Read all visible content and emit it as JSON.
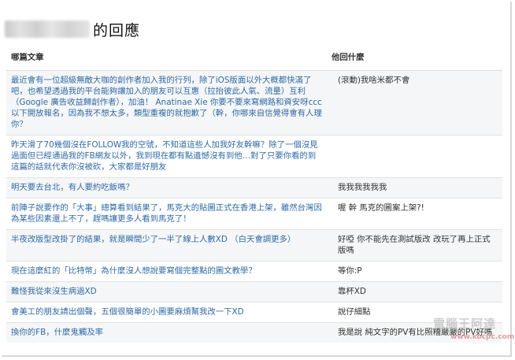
{
  "header": {
    "title_suffix": "的回應"
  },
  "table": {
    "col_post": "哪篇文章",
    "col_reply": "他回什麼",
    "rows": [
      {
        "post": "最近會有一位超級無敵大咖的創作者加入我的行列，除了iOS版面以外大概都快滿了吧，也希望透過我的平台能夠讓加入的朋友可以互惠（拉抬彼此人氣、流量）互利（Google 廣告收益歸創作者），加油！ Anatinae Xie 你要不要來寫網路和資安呀ccc 以下開放報名，因為我不想太多，類型重複的就抱歉了（幹，你哪來自信覺得會有人理你？",
        "reply": "(滾動)我啥米都不會"
      },
      {
        "post": "昨天滑了70幾個沒在FOLLOW我的空號，不知道這些人加我好友幹嘛？除了一個沒見過面但已經通過我的FB網友以外，我到現在都有點遺憾沒有到他…對了只要你看的到這篇的話就代表你沒被砍，大家都是好朋友",
        "reply": ""
      },
      {
        "post": "明天要去台北，有人要約吃飯嗎？",
        "reply": "我我我我我我"
      },
      {
        "post": "前陣子說要作的「大事」總算看到結果了，馬克大的貼圖正式在香港上架，雖然台灣因為某些因素還上不了，趕嗎讓更多人看到馬克了！",
        "reply": "喔 幹 馬克的圖案上架?!"
      },
      {
        "post": "半夜改版型改掛了的結果，就是瞬間少了一半了線上人數XD （白天會調更多）",
        "reply": "好啞 你不能先在測試版改 改玩了再上正式版嗎"
      },
      {
        "post": "現在這麼紅的「比特幣」為什麼沒人想說要寫個完整點的圖文教學？",
        "reply": "等你:P"
      },
      {
        "post": "難怪我從來沒生病過XD",
        "reply": "靠杯XD"
      },
      {
        "post": "會美工的朋友請出個聲，五個很簡單的小圖要麻煩幫我改一下XD",
        "reply": "說仔細點"
      },
      {
        "post": "換你的FB，什麼鬼觸及率",
        "reply": "我是說 純文字的PV有比照糟嚴嚴的PV好嗎"
      }
    ]
  },
  "watermark": {
    "text": "電腦王阿達",
    "url": "www.kocpc.com.tw"
  }
}
